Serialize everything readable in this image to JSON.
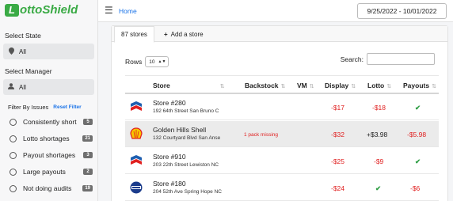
{
  "app": {
    "logo_text": "ottoShield",
    "logo_letter": "L"
  },
  "topbar": {
    "home": "Home",
    "date_range": "9/25/2022 - 10/01/2022"
  },
  "sidebar": {
    "state_label": "Select State",
    "state_value": "All",
    "manager_label": "Select Manager",
    "manager_value": "All",
    "filter_label": "Filter By Issues",
    "reset_label": "Reset Filter",
    "filters": [
      {
        "label": "Consistently short",
        "count": "5"
      },
      {
        "label": "Lotto shortages",
        "count": "21"
      },
      {
        "label": "Payout shortages",
        "count": "3"
      },
      {
        "label": "Large payouts",
        "count": "2"
      },
      {
        "label": "Not doing audits",
        "count": "19"
      }
    ]
  },
  "tabs": {
    "stores": "87 stores",
    "add": "Add a store"
  },
  "controls": {
    "rows_label": "Rows",
    "rows_value": "10",
    "search_label": "Search:"
  },
  "table": {
    "headers": {
      "store": "Store",
      "backstock": "Backstock",
      "vm": "VM",
      "display": "Display",
      "lotto": "Lotto",
      "payouts": "Payouts"
    },
    "rows": [
      {
        "brand": "chevron",
        "name": "Store #280",
        "address": "192 64th Street San Bruno C",
        "backstock": "",
        "display": "-$17",
        "lotto": "-$18",
        "payouts": "✔"
      },
      {
        "brand": "shell",
        "name": "Golden Hills Shell",
        "address": "132 Courtyard Blvd San Anse",
        "backstock": "1 pack missing",
        "display": "-$32",
        "lotto": "+$3.98",
        "payouts": "-$5.98"
      },
      {
        "brand": "chevron",
        "name": "Store #910",
        "address": "203 22th Street Lewiston NC",
        "backstock": "",
        "display": "-$25",
        "lotto": "-$9",
        "payouts": "✔"
      },
      {
        "brand": "sunoco",
        "name": "Store #180",
        "address": "204 52th Ave Spring Hope NC",
        "backstock": "",
        "display": "-$24",
        "lotto": "✔",
        "payouts": "-$6"
      }
    ]
  },
  "colors": {
    "brand_green": "#3aaa45",
    "link_blue": "#1a73e8",
    "negative": "#e02020",
    "check": "#2e9e44"
  }
}
